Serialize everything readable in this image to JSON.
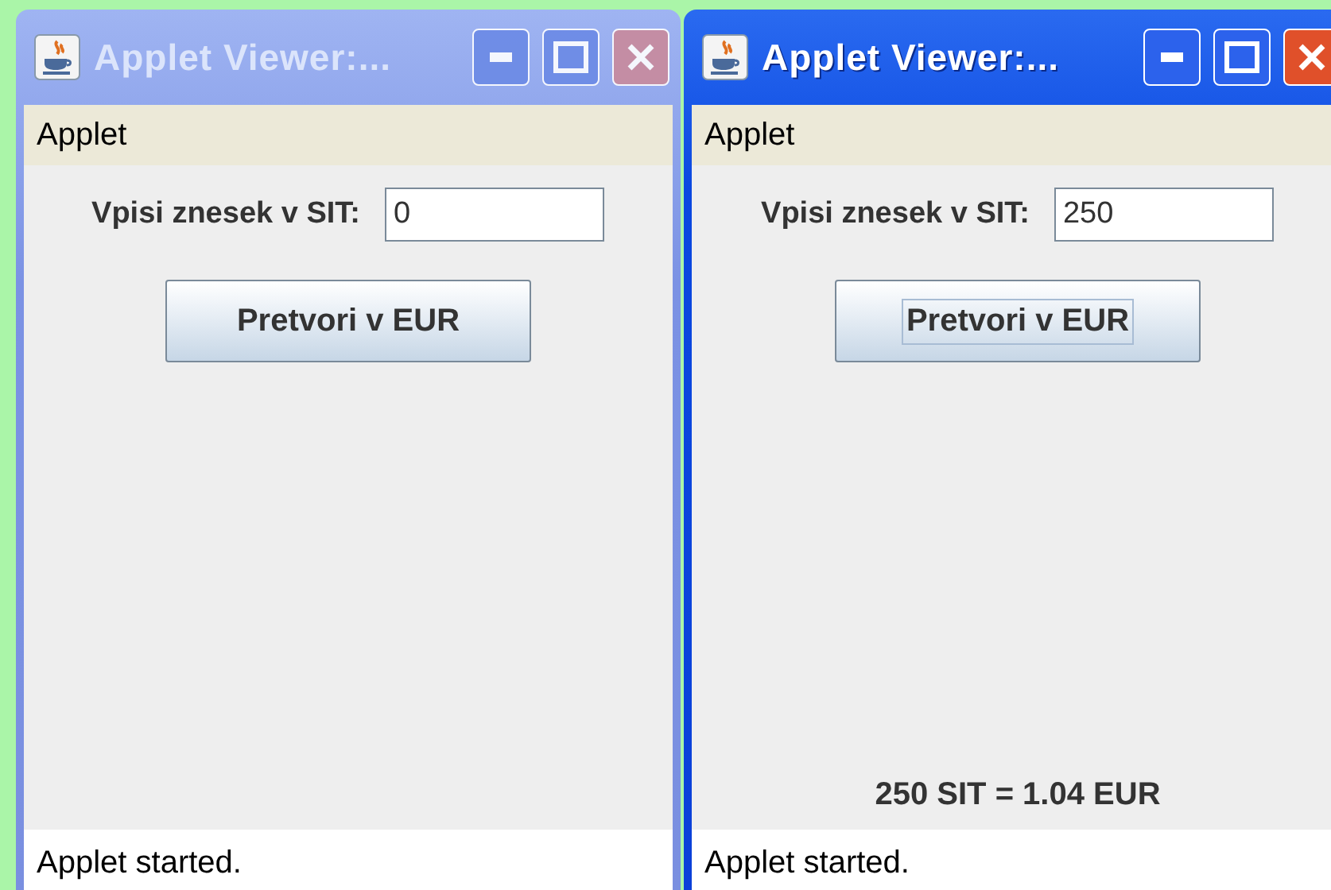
{
  "windows": [
    {
      "title": "Applet Viewer:...",
      "active": false,
      "menu": "Applet",
      "field_label": "Vpisi znesek v SIT:",
      "field_value": "0",
      "button": {
        "label": "Pretvori v EUR",
        "focused": false
      },
      "status": "Applet started."
    },
    {
      "title": "Applet Viewer:...",
      "active": true,
      "menu": "Applet",
      "field_label": "Vpisi znesek v SIT:",
      "field_value": "250",
      "button": {
        "label": "Pretvori v EUR",
        "focused": true
      },
      "result": "250 SIT = 1.04 EUR",
      "status": "Applet started."
    }
  ]
}
